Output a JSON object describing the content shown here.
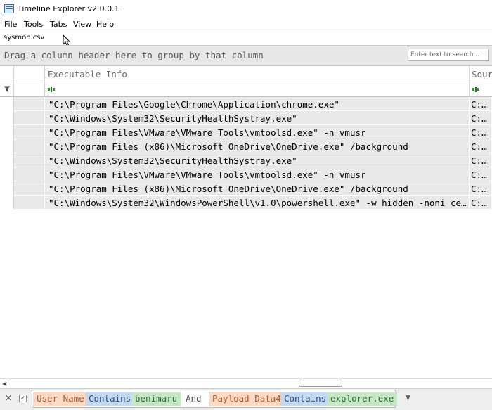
{
  "window": {
    "title": "Timeline Explorer v2.0.0.1",
    "icon": "app-grid-icon"
  },
  "menu": {
    "items": [
      {
        "label": "File"
      },
      {
        "label": "Tools"
      },
      {
        "label": "Tabs"
      },
      {
        "label": "View"
      },
      {
        "label": "Help"
      }
    ]
  },
  "tabs": [
    {
      "label": "sysmon.csv"
    }
  ],
  "group_panel": {
    "hint": "Drag a column header here to group by that column"
  },
  "search": {
    "placeholder": "Enter text to search..."
  },
  "grid": {
    "columns": [
      {
        "label": ""
      },
      {
        "label": "Executable Info"
      },
      {
        "label": "Sourc"
      }
    ],
    "rows": [
      {
        "exec": "\"C:\\Program Files\\Google\\Chrome\\Application\\chrome.exe\"",
        "source": "C:\\U"
      },
      {
        "exec": "\"C:\\Windows\\System32\\SecurityHealthSystray.exe\"",
        "source": "C:\\U"
      },
      {
        "exec": "\"C:\\Program Files\\VMware\\VMware Tools\\vmtoolsd.exe\" -n vmusr",
        "source": "C:\\U"
      },
      {
        "exec": "\"C:\\Program Files (x86)\\Microsoft OneDrive\\OneDrive.exe\" /background",
        "source": "C:\\U"
      },
      {
        "exec": "\"C:\\Windows\\System32\\SecurityHealthSystray.exe\"",
        "source": "C:\\U"
      },
      {
        "exec": "\"C:\\Program Files\\VMware\\VMware Tools\\vmtoolsd.exe\" -n vmusr",
        "source": "C:\\U"
      },
      {
        "exec": "\"C:\\Program Files (x86)\\Microsoft OneDrive\\OneDrive.exe\" /background",
        "source": "C:\\U"
      },
      {
        "exec": "\"C:\\Windows\\System32\\WindowsPowerShell\\v1.0\\powershell.exe\" -w hidden -noni certutil",
        "source": "C:\\U"
      }
    ]
  },
  "filter": {
    "field1": "User Name",
    "op1": "Contains",
    "value1": "benimaru",
    "join": "And",
    "field2": "Payload Data4",
    "op2": "Contains",
    "value2": "explorer.exe"
  },
  "colors": {
    "field": "#fbd9c2",
    "operator": "#c3d9ef",
    "value": "#c6e6c6",
    "row": "#e9e9e9"
  }
}
